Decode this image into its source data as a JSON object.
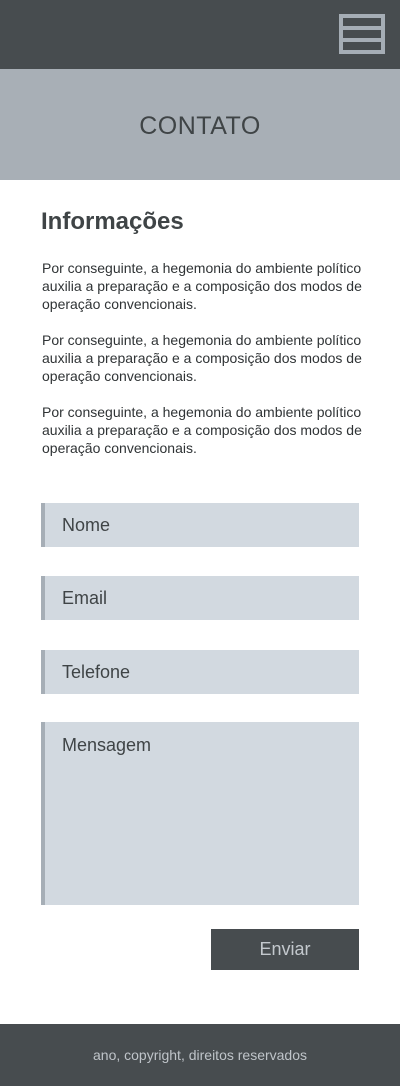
{
  "header": {
    "menu_icon": "hamburger-menu-icon"
  },
  "hero": {
    "title": "CONTATO"
  },
  "info": {
    "heading": "Informações",
    "paragraphs": [
      "Por conseguinte, a hegemonia do ambiente político auxilia a preparação e a composição dos modos de operação convencionais.",
      "Por conseguinte, a hegemonia do ambiente político auxilia a preparação e a composição dos modos de operação convencionais.",
      "Por conseguinte, a hegemonia do ambiente político auxilia a preparação e a composição dos modos de operação convencionais."
    ]
  },
  "form": {
    "name_placeholder": "Nome",
    "email_placeholder": "Email",
    "phone_placeholder": "Telefone",
    "message_placeholder": "Mensagem",
    "submit_label": "Enviar"
  },
  "footer": {
    "text": "ano, copyright, direitos reservados"
  },
  "colors": {
    "header_bg": "#474c4f",
    "hero_bg": "#a8afb6",
    "field_bg": "#d2d9e0",
    "field_accent": "#a6aeb6",
    "button_bg": "#474c4f",
    "text": "#3f4446"
  }
}
